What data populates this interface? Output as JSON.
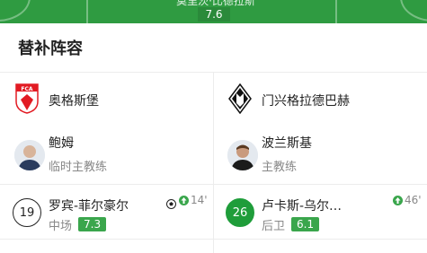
{
  "pitch": {
    "player_name": "莫里茨·比德拉斯",
    "player_rating": "7.6"
  },
  "section_title": "替补阵容",
  "home": {
    "team_name": "奥格斯堡",
    "coach": {
      "name": "鲍姆",
      "role": "临时主教练"
    },
    "subs": [
      {
        "number": "19",
        "name": "罗宾-菲尔豪尔",
        "position": "中场",
        "rating": "7.3",
        "minute": "14'",
        "goal": true
      }
    ]
  },
  "away": {
    "team_name": "门兴格拉德巴赫",
    "coach": {
      "name": "波兰斯基",
      "role": "主教练"
    },
    "subs": [
      {
        "number": "26",
        "name": "卢卡斯-乌尔…",
        "position": "后卫",
        "rating": "6.1",
        "minute": "46'",
        "goal": false
      }
    ]
  },
  "colors": {
    "pitch": "#2f9b41",
    "rating": "#3aa64c",
    "home_logo_red": "#e21b23",
    "away_logo": "#111111"
  }
}
